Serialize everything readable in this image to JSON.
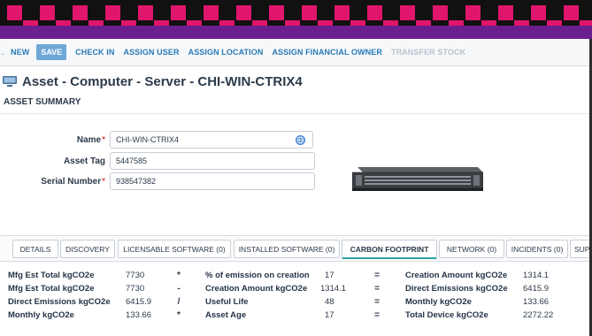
{
  "banner": {
    "colors": {
      "pink": "#e0156c",
      "purple": "#6b1f8e",
      "black": "#111111"
    }
  },
  "toolbar": {
    "items": [
      "NEW",
      "SAVE",
      "CHECK IN",
      "ASSIGN USER",
      "ASSIGN LOCATION",
      "ASSIGN FINANCIAL OWNER",
      "TRANSFER STOCK"
    ],
    "accent": "#2a7ab5"
  },
  "page": {
    "title": "Asset - Computer - Server - CHI-WIN-CTRIX4",
    "section": "ASSET SUMMARY"
  },
  "form": {
    "name_label": "Name",
    "name_value": "CHI-WIN-CTRIX4",
    "asset_tag_label": "Asset Tag",
    "asset_tag_value": "5447585",
    "serial_label": "Serial Number",
    "serial_value": "938547382"
  },
  "tabs": [
    "DETAILS",
    "DISCOVERY",
    "LICENSABLE SOFTWARE (0)",
    "INSTALLED SOFTWARE (0)",
    "CARBON FOOTPRINT",
    "NETWORK (0)",
    "INCIDENTS (0)",
    "SUP"
  ],
  "active_tab": "CARBON FOOTPRINT",
  "carbon": {
    "rows": [
      {
        "l1": "Mfg Est Total kgCO2e",
        "v1": "7730",
        "op1": "*",
        "l2": "% of emission on creation",
        "v2": "17",
        "op2": "=",
        "l3": "Creation Amount kgCO2e",
        "v3": "1314.1"
      },
      {
        "l1": "Mfg Est Total kgCO2e",
        "v1": "7730",
        "op1": "-",
        "l2": "Creation Amount kgCO2e",
        "v2": "1314.1",
        "op2": "=",
        "l3": "Direct Emissions kgCO2e",
        "v3": "6415.9"
      },
      {
        "l1": "Direct Emissions kgCO2e",
        "v1": "6415.9",
        "op1": "/",
        "l2": "Useful Life",
        "v2": "48",
        "op2": "=",
        "l3": "Monthly kgCO2e",
        "v3": "133.66"
      },
      {
        "l1": "Monthly kgCO2e",
        "v1": "133.66",
        "op1": "*",
        "l2": "Asset Age",
        "v2": "17",
        "op2": "=",
        "l3": "Total Device kgCO2e",
        "v3": "2272.22"
      }
    ]
  }
}
